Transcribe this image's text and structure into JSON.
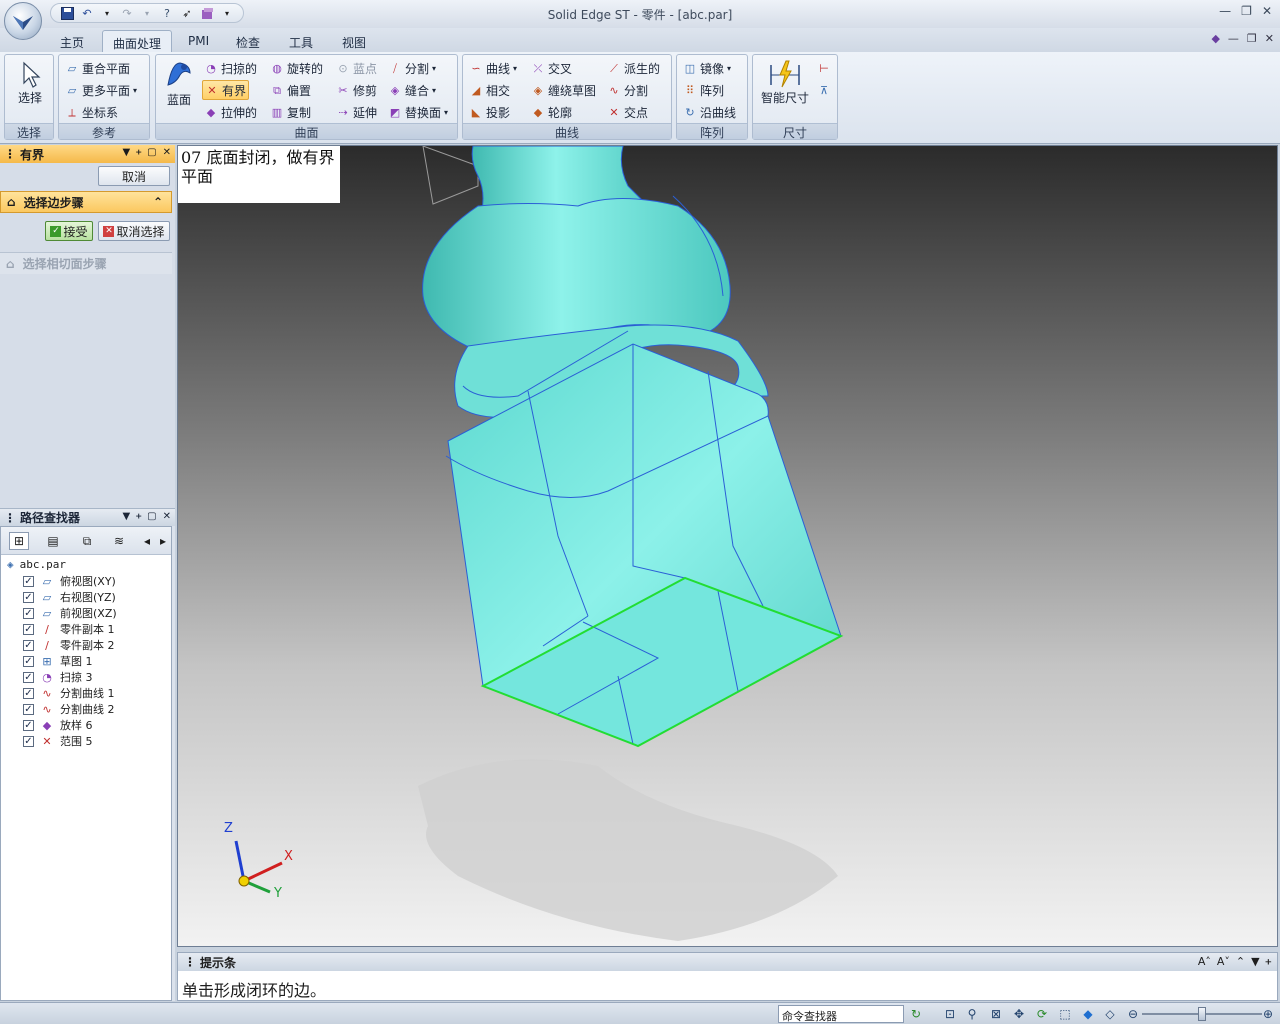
{
  "window": {
    "title": "Solid Edge ST - 零件 - [abc.par]"
  },
  "tabs": [
    {
      "label": "主页",
      "active": false
    },
    {
      "label": "曲面处理",
      "active": true
    },
    {
      "label": "PMI",
      "active": false
    },
    {
      "label": "检查",
      "active": false
    },
    {
      "label": "工具",
      "active": false
    },
    {
      "label": "视图",
      "active": false
    }
  ],
  "ribbon": {
    "select_group": {
      "button": "选择",
      "label": "选择"
    },
    "reference_group": {
      "label": "参考",
      "items": [
        "重合平面",
        "更多平面",
        "坐标系"
      ]
    },
    "surface_group": {
      "label": "曲面",
      "blue_surface": "蓝面",
      "col1": [
        "扫掠的",
        "有界",
        "拉伸的"
      ],
      "col2": [
        "旋转的",
        "偏置",
        "复制"
      ],
      "col3": [
        "蓝点",
        "修剪",
        "延伸"
      ],
      "col4": [
        "分割",
        "缝合",
        "替换面"
      ]
    },
    "curve_group": {
      "label": "曲线",
      "col1": [
        "曲线",
        "相交",
        "投影"
      ],
      "col2": [
        "交叉",
        "缠绕草图",
        "轮廓"
      ],
      "col3": [
        "派生的",
        "分割",
        "交点"
      ]
    },
    "pattern_group": {
      "label": "阵列",
      "items": [
        "镜像",
        "阵列",
        "沿曲线"
      ]
    },
    "dimension_group": {
      "label": "尺寸",
      "button": "智能尺寸"
    }
  },
  "command_panel": {
    "title": "有界",
    "cancel": "取消",
    "step_select_edge": "选择边步骤",
    "accept": "接受",
    "deselect": "取消选择",
    "step_select_tangent": "选择相切面步骤"
  },
  "pathfinder": {
    "title": "路径查找器",
    "root": "abc.par",
    "items": [
      {
        "label": "俯视图(XY)",
        "checked": true,
        "icon": "plane-icon"
      },
      {
        "label": "右视图(YZ)",
        "checked": true,
        "icon": "plane-icon"
      },
      {
        "label": "前视图(XZ)",
        "checked": true,
        "icon": "plane-icon"
      },
      {
        "label": "零件副本 1",
        "checked": true,
        "icon": "curve-icon"
      },
      {
        "label": "零件副本 2",
        "checked": true,
        "icon": "curve-icon"
      },
      {
        "label": "草图 1",
        "checked": true,
        "icon": "sketch-icon"
      },
      {
        "label": "扫掠 3",
        "checked": true,
        "icon": "sweep-icon"
      },
      {
        "label": "分割曲线 1",
        "checked": true,
        "icon": "split-curve-icon"
      },
      {
        "label": "分割曲线 2",
        "checked": true,
        "icon": "split-curve-icon"
      },
      {
        "label": "放样 6",
        "checked": true,
        "icon": "loft-icon"
      },
      {
        "label": "范围 5",
        "checked": true,
        "icon": "bounded-icon"
      }
    ]
  },
  "viewport": {
    "note": "07 底面封闭，做有界平面",
    "axis_labels": {
      "x": "X",
      "y": "Y",
      "z": "Z"
    },
    "model_color": "#7ee8df",
    "edge_color": "#2a5fd6",
    "selected_edge_color": "#22dd33"
  },
  "prompt": {
    "title": "提示条",
    "text": "单击形成闭环的边。"
  },
  "statusbar": {
    "command_finder": "命令查找器"
  }
}
